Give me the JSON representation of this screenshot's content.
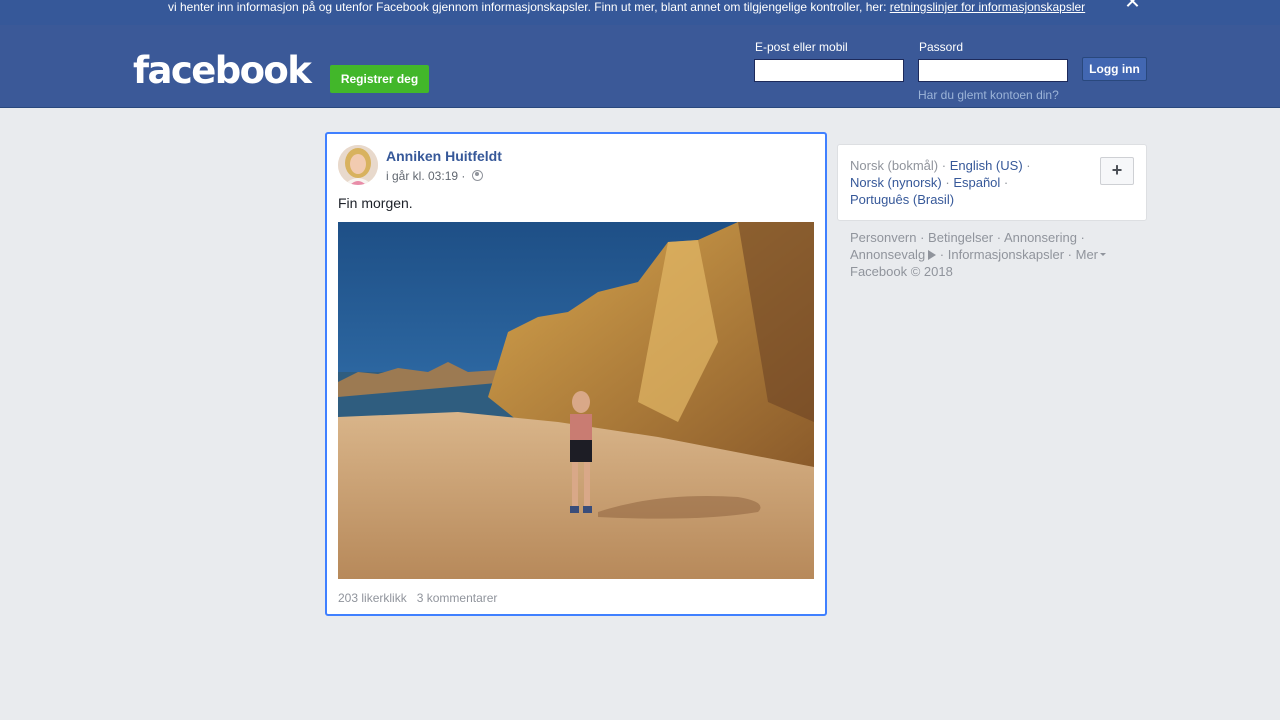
{
  "cookie_banner": {
    "text": "vi henter inn informasjon på og utenfor Facebook gjennom informasjonskapsler. Finn ut mer, blant annet om tilgjengelige kontroller, her: ",
    "link": "retningslinjer for informasjonskapsler",
    "close_icon": "close-icon"
  },
  "header": {
    "logo": "facebook",
    "register_label": "Registrer deg",
    "email_label": "E-post eller mobil",
    "email_value": "",
    "password_label": "Passord",
    "password_value": "",
    "login_label": "Logg inn",
    "forgot_link": "Har du glemt kontoen din?"
  },
  "post": {
    "author": "Anniken Huitfeldt",
    "timestamp": "i går kl. 03:19 · ",
    "privacy_icon": "globe-icon",
    "text": "Fin morgen.",
    "likes": "203 likerklikk",
    "comments": "3 kommentarer"
  },
  "languages": {
    "current": "Norsk (bokmål)",
    "options": [
      "English (US)",
      "Norsk (nynorsk)",
      "Español",
      "Português (Brasil)"
    ],
    "more_icon": "plus-icon"
  },
  "footer": {
    "links": [
      "Personvern",
      "Betingelser",
      "Annonsering",
      "Annonsevalg",
      "Informasjonskapsler",
      "Mer"
    ],
    "adchoices_icon": "adchoices-icon",
    "copyright": "Facebook © 2018"
  },
  "colors": {
    "brand_blue": "#3b5998",
    "cookie_bar": "#365899",
    "register_green": "#42b72a",
    "link_blue": "#365899",
    "focus_border": "#4080ff",
    "background": "#e9ebee"
  }
}
